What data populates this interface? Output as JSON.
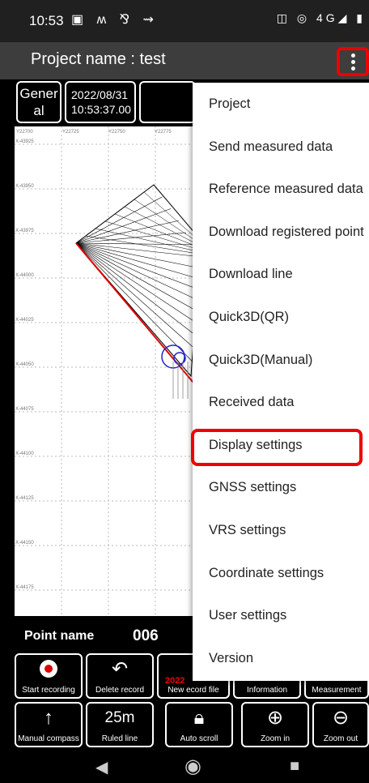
{
  "status": {
    "time": "10:53",
    "left_icons": "▣ ʍ ⅋ ⇝",
    "right_icons": "◫ ◎ 4G◢ ▮"
  },
  "appbar": {
    "title": "Project name : test"
  },
  "info": {
    "general": "Gener al",
    "date": "2022/08/31",
    "time": "10:53:37.00"
  },
  "map": {
    "top_labels": [
      "Y22700",
      "Y22725",
      "Y22750",
      "Y22775"
    ],
    "left_labels": [
      "X-43925",
      "X-43950",
      "X-43975",
      "X-44000",
      "X-44025",
      "X-44050",
      "X-44075",
      "X-44100",
      "X-44125",
      "X-44150",
      "X-44175"
    ]
  },
  "point": {
    "label": "Point name",
    "value": "006"
  },
  "tools": {
    "start_recording": "Start recording",
    "delete_record": "Delete record",
    "new_record_file": "New ecord file",
    "new_record_overlay": "2022",
    "information": "Information",
    "measurement": "Measurement",
    "manual_compass": "Manual compass",
    "ruled_line_value": "25m",
    "ruled_line": "Ruled line",
    "auto_scroll": "Auto scroll",
    "zoom_in": "Zoom in",
    "zoom_out": "Zoom out"
  },
  "menu": {
    "items": [
      "Project",
      "Send measured data",
      "Reference measured data",
      "Download registered point",
      "Download line",
      "Quick3D(QR)",
      "Quick3D(Manual)",
      "Received data",
      "Display settings",
      "GNSS settings",
      "VRS settings",
      "Coordinate settings",
      "User settings",
      "Version"
    ],
    "highlighted": "Display settings"
  },
  "colors": {
    "highlight": "#ee0000",
    "boundary": "#dd0000",
    "marker": "#2222cc"
  }
}
